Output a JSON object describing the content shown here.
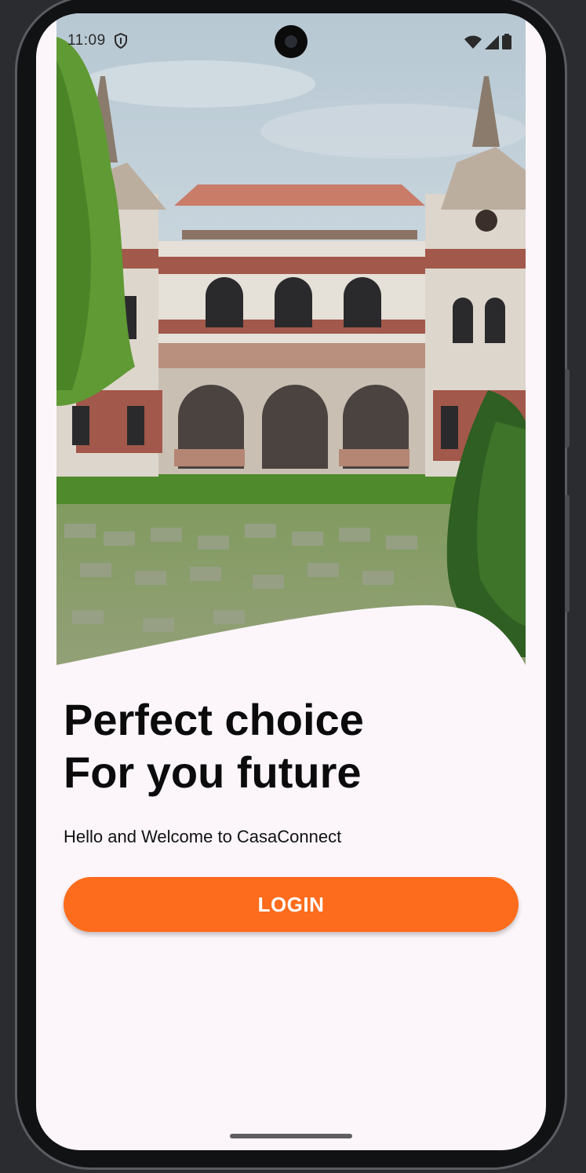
{
  "status_bar": {
    "time": "11:09",
    "shield_icon": "shield-icon",
    "wifi_icon": "wifi-icon",
    "signal_icon": "cellular-signal-icon",
    "battery_icon": "battery-icon"
  },
  "hero": {
    "image": "photo of a historic mansion with red tiled roof, arched windows, overgrown cobbled courtyard and evergreen trees"
  },
  "headline": {
    "line1": "Perfect choice",
    "line2": "For you future"
  },
  "subtitle": "Hello and Welcome to CasaConnect",
  "login_button": {
    "label": "LOGIN"
  },
  "colors": {
    "accent": "#fd6c1c",
    "background": "#fcf6fb",
    "text": "#0b0b0c"
  }
}
